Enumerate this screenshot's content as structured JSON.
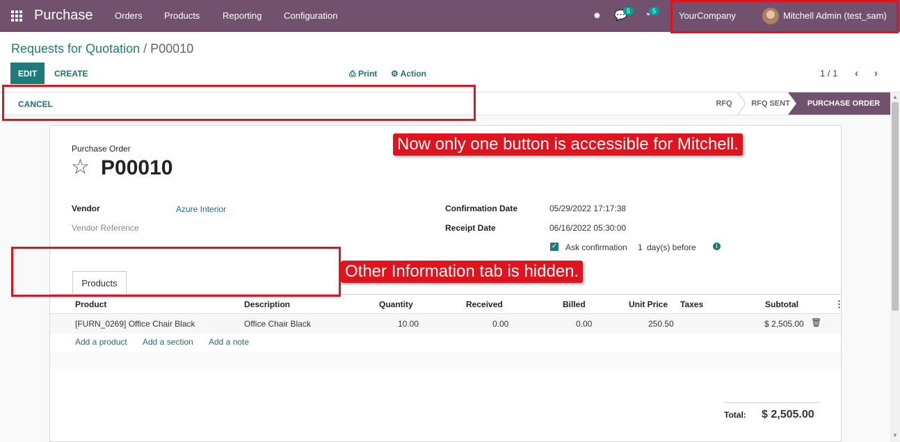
{
  "topbar": {
    "app_title": "Purchase",
    "menu": [
      "Orders",
      "Products",
      "Reporting",
      "Configuration"
    ],
    "messages_count": "5",
    "activities_count": "5",
    "company": "YourCompany",
    "user": "Mitchell Admin (test_sam)"
  },
  "breadcrumb": {
    "parent": "Requests for Quotation",
    "separator": "/",
    "current": "P00010"
  },
  "toolbar": {
    "edit_label": "EDIT",
    "create_label": "CREATE",
    "print_label": "Print",
    "action_label": "Action",
    "pager": "1 / 1"
  },
  "statusbar": {
    "cancel_label": "CANCEL",
    "stages": [
      "RFQ",
      "RFQ SENT",
      "PURCHASE ORDER"
    ],
    "active_stage": "PURCHASE ORDER"
  },
  "form": {
    "title_label": "Purchase Order",
    "name": "P00010",
    "vendor_label": "Vendor",
    "vendor": "Azure Interior",
    "vendor_ref_label": "Vendor Reference",
    "confirmation_date_label": "Confirmation Date",
    "confirmation_date": "05/29/2022 17:17:38",
    "receipt_date_label": "Receipt Date",
    "receipt_date": "06/16/2022 05:30:00",
    "ask_confirmation_label": "Ask confirmation",
    "ask_confirmation_days": "1",
    "ask_confirmation_suffix": "day(s) before",
    "ask_confirmation_checked": true
  },
  "tabs": [
    "Products"
  ],
  "lines": {
    "headers": [
      "Product",
      "Description",
      "Quantity",
      "Received",
      "Billed",
      "Unit Price",
      "Taxes",
      "Subtotal"
    ],
    "rows": [
      {
        "product": "[FURN_0269] Office Chair Black",
        "description": "Office Chair Black",
        "quantity": "10.00",
        "received": "0.00",
        "billed": "0.00",
        "unit_price": "250.50",
        "taxes": "",
        "subtotal": "$ 2,505.00"
      }
    ],
    "add_product": "Add a product",
    "add_section": "Add a section",
    "add_note": "Add a note"
  },
  "totals": {
    "total_label": "Total:",
    "total_value": "$ 2,505.00"
  },
  "annotations": {
    "callout_buttons": "Now only one button is accessible for Mitchell.",
    "callout_tab": "Other Information tab is hidden."
  },
  "colors": {
    "brand": "#71516e",
    "accent": "#1e7b7b",
    "annotation": "#e0141e"
  }
}
